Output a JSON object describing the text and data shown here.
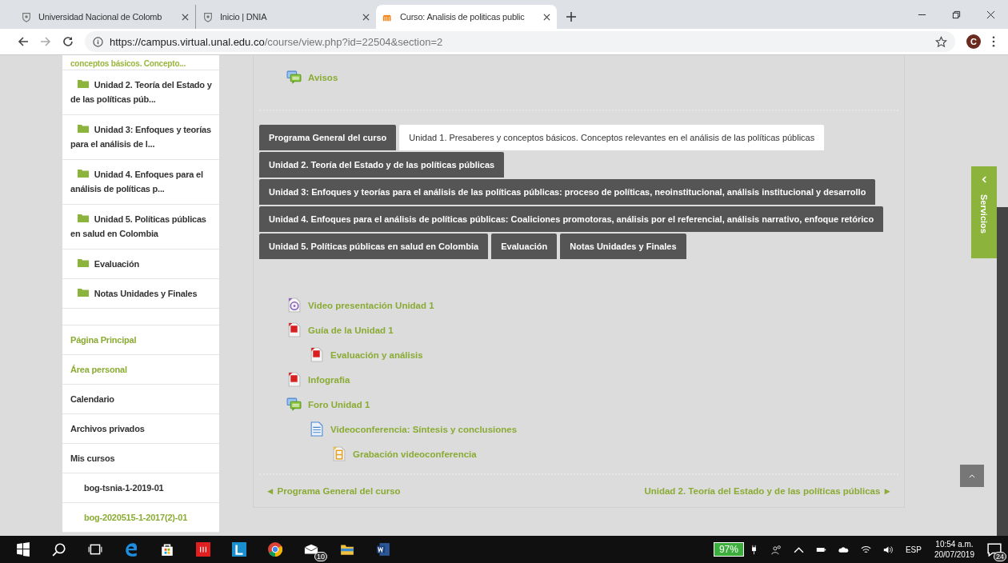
{
  "browser": {
    "tabs": [
      {
        "title": "Universidad Nacional de Colomb",
        "kind": "crest",
        "selected": false
      },
      {
        "title": "Inicio | DNIA",
        "kind": "crest",
        "selected": false
      },
      {
        "title": "Curso: Analisis de politicas public",
        "kind": "moodle",
        "selected": true
      }
    ],
    "url_host": "https://campus.virtual.unal.edu.co",
    "url_path": "/course/view.php?id=22504&section=2",
    "profile_initial": "C"
  },
  "sidebar": {
    "cut_item": "conceptos básicos. Concepto...",
    "sections": [
      {
        "label": "Unidad 2. Teoría del Estado y de las políticas púb..."
      },
      {
        "label": "Unidad 3: Enfoques y teorías para el análisis de l..."
      },
      {
        "label": "Unidad 4. Enfoques para el análisis de políticas p..."
      },
      {
        "label": "Unidad 5. Políticas públicas en salud en Colombia"
      },
      {
        "label": "Evaluación"
      },
      {
        "label": "Notas Unidades y Finales"
      }
    ],
    "nav": [
      {
        "label": "Página Principal",
        "kind": "link"
      },
      {
        "label": "Área personal",
        "kind": "link"
      },
      {
        "label": "Calendario",
        "kind": "node"
      },
      {
        "label": "Archivos privados",
        "kind": "node"
      },
      {
        "label": "Mis cursos",
        "kind": "node",
        "children": [
          {
            "label": "bog-tsnia-1-2019-01",
            "kind": "node"
          },
          {
            "label": "bog-2020515-1-2017(2)-01",
            "kind": "link"
          }
        ]
      }
    ]
  },
  "top_activity": {
    "label": "Avisos",
    "kind": "forum"
  },
  "tab_rows": [
    [
      {
        "label": "Programa General del curso",
        "selected": false
      },
      {
        "label": "Unidad 1. Presaberes y conceptos básicos. Conceptos relevantes en el análisis de las políticas públicas",
        "selected": true
      }
    ],
    [
      {
        "label": "Unidad 2. Teoría del Estado y de las políticas públicas",
        "selected": false
      }
    ],
    [
      {
        "label": "Unidad 3: Enfoques y teorías para el análisis de las políticas públicas: proceso de políticas, neoinstitucional, análisis institucional y desarrollo",
        "selected": false
      }
    ],
    [
      {
        "label": "Unidad 4. Enfoques para el análisis de políticas públicas: Coaliciones promotoras, análisis por el referencial, análisis narrativo, enfoque retórico",
        "selected": false
      }
    ],
    [
      {
        "label": "Unidad 5. Políticas públicas en salud en Colombia",
        "selected": false
      },
      {
        "label": "Evaluación",
        "selected": false
      },
      {
        "label": "Notas Unidades y Finales",
        "selected": false
      }
    ]
  ],
  "activities": [
    {
      "label": "Video presentación Unidad 1",
      "kind": "video"
    },
    {
      "label": "Guía de la Unidad 1",
      "kind": "pdf",
      "children": [
        {
          "label": "Evaluación y análisis",
          "kind": "pdf"
        }
      ]
    },
    {
      "label": "Infografia",
      "kind": "pdf"
    },
    {
      "label": "Foro Unidad 1",
      "kind": "forum",
      "children": [
        {
          "label": "Videoconferencia: Síntesis y conclusiones",
          "kind": "page",
          "children": [
            {
              "label": "Grabación videoconferencia",
              "kind": "file"
            }
          ]
        }
      ]
    }
  ],
  "section_nav": {
    "previous": "◄ Programa General del curso",
    "next": "Unidad 2. Teoría del Estado y de las políticas públicas ►"
  },
  "drawer": {
    "label": "Servicios"
  },
  "taskbar": {
    "mail_count": "10",
    "battery": "97%",
    "language": "ESP",
    "time": "10:54 a.m.",
    "date": "20/07/2019",
    "notifications": "24"
  }
}
